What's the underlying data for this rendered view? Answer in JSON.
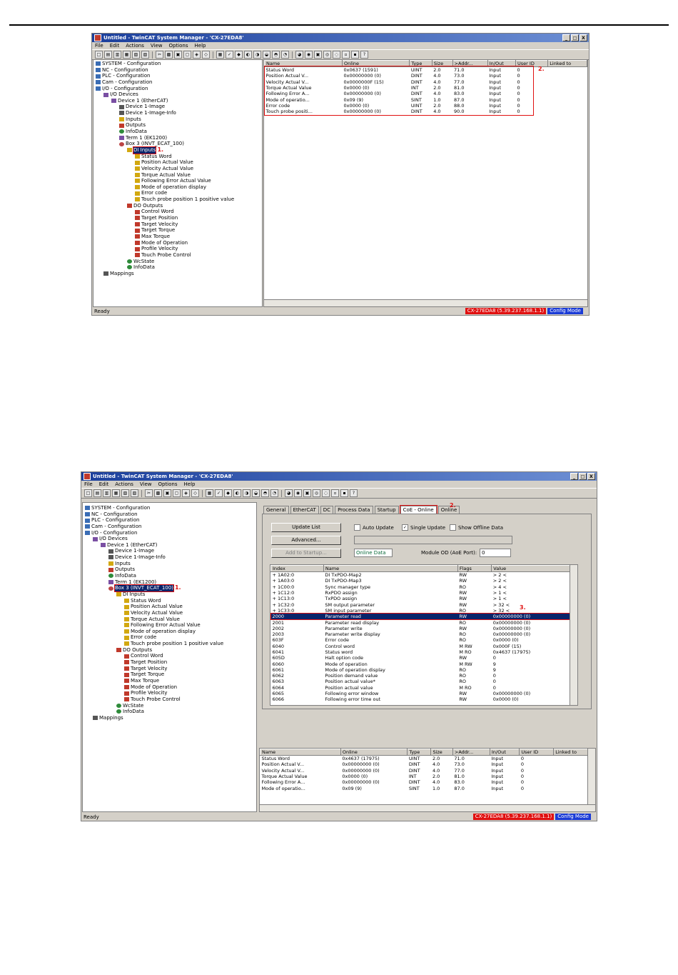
{
  "window_title": "Untitled - TwinCAT System Manager - 'CX-27EDA8'",
  "window_controls": [
    "_",
    "□",
    "X"
  ],
  "menu": [
    "File",
    "Edit",
    "Actions",
    "View",
    "Options",
    "Help"
  ],
  "status": {
    "ready": "Ready",
    "target": "CX-27EDA8 (5.39.237.168.1.1)",
    "mode": "Config Mode"
  },
  "callouts": {
    "one": "1.",
    "two": "2.",
    "three": "3."
  },
  "s1": {
    "tree": [
      {
        "label": "SYSTEM - Configuration",
        "indent": 0,
        "icon": "sys"
      },
      {
        "label": "NC - Configuration",
        "indent": 0,
        "icon": "sys"
      },
      {
        "label": "PLC - Configuration",
        "indent": 0,
        "icon": "sys"
      },
      {
        "label": "Cam - Configuration",
        "indent": 0,
        "icon": "sys"
      },
      {
        "label": "I/O - Configuration",
        "indent": 0,
        "icon": "sys"
      },
      {
        "label": "I/O Devices",
        "indent": 1,
        "icon": "dev"
      },
      {
        "label": "Device 1 (EtherCAT)",
        "indent": 2,
        "icon": "dev"
      },
      {
        "label": "Device 1-Image",
        "indent": 3,
        "icon": "map"
      },
      {
        "label": "Device 1-Image-Info",
        "indent": 3,
        "icon": "map"
      },
      {
        "label": "Inputs",
        "indent": 3,
        "icon": "in"
      },
      {
        "label": "Outputs",
        "indent": 3,
        "icon": "out"
      },
      {
        "label": "InfoData",
        "indent": 3,
        "icon": "ok"
      },
      {
        "label": "Term 1 (EK1200)",
        "indent": 3,
        "icon": "dev"
      },
      {
        "label": "Box 3 (INVT_ECAT_100)",
        "indent": 3,
        "icon": "box"
      },
      {
        "label": "DI Inputs",
        "indent": 4,
        "icon": "in",
        "hl": true,
        "callout": "1."
      },
      {
        "label": "Status Word",
        "indent": 5,
        "icon": "in"
      },
      {
        "label": "Position Actual Value",
        "indent": 5,
        "icon": "in"
      },
      {
        "label": "Velocity Actual Value",
        "indent": 5,
        "icon": "in"
      },
      {
        "label": "Torque Actual Value",
        "indent": 5,
        "icon": "in"
      },
      {
        "label": "Following Error Actual Value",
        "indent": 5,
        "icon": "in"
      },
      {
        "label": "Mode of operation display",
        "indent": 5,
        "icon": "in"
      },
      {
        "label": "Error code",
        "indent": 5,
        "icon": "in"
      },
      {
        "label": "Touch probe position 1 positive value",
        "indent": 5,
        "icon": "in"
      },
      {
        "label": "DO Outputs",
        "indent": 4,
        "icon": "out"
      },
      {
        "label": "Control Word",
        "indent": 5,
        "icon": "out"
      },
      {
        "label": "Target Position",
        "indent": 5,
        "icon": "out"
      },
      {
        "label": "Target Velocity",
        "indent": 5,
        "icon": "out"
      },
      {
        "label": "Target Torque",
        "indent": 5,
        "icon": "out"
      },
      {
        "label": "Max Torque",
        "indent": 5,
        "icon": "out"
      },
      {
        "label": "Mode of Operation",
        "indent": 5,
        "icon": "out"
      },
      {
        "label": "Profile Velocity",
        "indent": 5,
        "icon": "out"
      },
      {
        "label": "Touch Probe Control",
        "indent": 5,
        "icon": "out"
      },
      {
        "label": "WcState",
        "indent": 4,
        "icon": "ok"
      },
      {
        "label": "InfoData",
        "indent": 4,
        "icon": "ok"
      },
      {
        "label": "Mappings",
        "indent": 1,
        "icon": "map"
      }
    ],
    "var_headers": [
      "Name",
      "Online",
      "Type",
      "Size",
      ">Addr...",
      "In/Out",
      "User ID",
      "Linked to"
    ],
    "var_rows": [
      [
        "Status Word",
        "0x0637 (1591)",
        "UINT",
        "2.0",
        "71.0",
        "Input",
        "0"
      ],
      [
        "Position Actual V...",
        "0x00000000 (0)",
        "DINT",
        "4.0",
        "73.0",
        "Input",
        "0"
      ],
      [
        "Velocity Actual V...",
        "0x0000000F (15)",
        "DINT",
        "4.0",
        "77.0",
        "Input",
        "0"
      ],
      [
        "Torque Actual Value",
        "0x0000 (0)",
        "INT",
        "2.0",
        "81.0",
        "Input",
        "0"
      ],
      [
        "Following Error A...",
        "0x00000000 (0)",
        "DINT",
        "4.0",
        "83.0",
        "Input",
        "0"
      ],
      [
        "Mode of operatio...",
        "0x09 (9)",
        "SINT",
        "1.0",
        "87.0",
        "Input",
        "0"
      ],
      [
        "Error code",
        "0x0000 (0)",
        "UINT",
        "2.0",
        "88.0",
        "Input",
        "0"
      ],
      [
        "Touch probe positi...",
        "0x00000000 (0)",
        "DINT",
        "4.0",
        "90.0",
        "Input",
        "0"
      ]
    ]
  },
  "s2": {
    "tree": [
      {
        "label": "SYSTEM - Configuration",
        "indent": 0,
        "icon": "sys"
      },
      {
        "label": "NC - Configuration",
        "indent": 0,
        "icon": "sys"
      },
      {
        "label": "PLC - Configuration",
        "indent": 0,
        "icon": "sys"
      },
      {
        "label": "Cam - Configuration",
        "indent": 0,
        "icon": "sys"
      },
      {
        "label": "I/O - Configuration",
        "indent": 0,
        "icon": "sys"
      },
      {
        "label": "I/O Devices",
        "indent": 1,
        "icon": "dev"
      },
      {
        "label": "Device 1 (EtherCAT)",
        "indent": 2,
        "icon": "dev"
      },
      {
        "label": "Device 1-Image",
        "indent": 3,
        "icon": "map"
      },
      {
        "label": "Device 1-Image-Info",
        "indent": 3,
        "icon": "map"
      },
      {
        "label": "Inputs",
        "indent": 3,
        "icon": "in"
      },
      {
        "label": "Outputs",
        "indent": 3,
        "icon": "out"
      },
      {
        "label": "InfoData",
        "indent": 3,
        "icon": "ok"
      },
      {
        "label": "Term 1 (EK1200)",
        "indent": 3,
        "icon": "dev"
      },
      {
        "label": "Box 3 (INVT_ECAT_100)",
        "indent": 3,
        "icon": "box",
        "hl": true,
        "callout": "1."
      },
      {
        "label": "DI Inputs",
        "indent": 4,
        "icon": "in"
      },
      {
        "label": "Status Word",
        "indent": 5,
        "icon": "in"
      },
      {
        "label": "Position Actual Value",
        "indent": 5,
        "icon": "in"
      },
      {
        "label": "Velocity Actual Value",
        "indent": 5,
        "icon": "in"
      },
      {
        "label": "Torque Actual Value",
        "indent": 5,
        "icon": "in"
      },
      {
        "label": "Following Error Actual Value",
        "indent": 5,
        "icon": "in"
      },
      {
        "label": "Mode of operation display",
        "indent": 5,
        "icon": "in"
      },
      {
        "label": "Error code",
        "indent": 5,
        "icon": "in"
      },
      {
        "label": "Touch probe position 1 positive value",
        "indent": 5,
        "icon": "in"
      },
      {
        "label": "DO Outputs",
        "indent": 4,
        "icon": "out"
      },
      {
        "label": "Control Word",
        "indent": 5,
        "icon": "out"
      },
      {
        "label": "Target Position",
        "indent": 5,
        "icon": "out"
      },
      {
        "label": "Target Velocity",
        "indent": 5,
        "icon": "out"
      },
      {
        "label": "Target Torque",
        "indent": 5,
        "icon": "out"
      },
      {
        "label": "Max Torque",
        "indent": 5,
        "icon": "out"
      },
      {
        "label": "Mode of Operation",
        "indent": 5,
        "icon": "out"
      },
      {
        "label": "Profile Velocity",
        "indent": 5,
        "icon": "out"
      },
      {
        "label": "Touch Probe Control",
        "indent": 5,
        "icon": "out"
      },
      {
        "label": "WcState",
        "indent": 4,
        "icon": "ok"
      },
      {
        "label": "InfoData",
        "indent": 4,
        "icon": "ok"
      },
      {
        "label": "Mappings",
        "indent": 1,
        "icon": "map"
      }
    ],
    "tabs": [
      "General",
      "EtherCAT",
      "DC",
      "Process Data",
      "Startup",
      "CoE - Online",
      "Online"
    ],
    "active_tab": "CoE - Online",
    "update_list": "Update List",
    "auto_update": "Auto Update",
    "single_update": "Single Update",
    "show_offline": "Show Offline Data",
    "advanced": "Advanced...",
    "add_to_startup": "Add to Startup...",
    "online_data": "Online Data",
    "module_od_label": "Module OD (AoE Port):",
    "module_od_value": "0",
    "od_headers": [
      "Index",
      "Name",
      "Flags",
      "Value"
    ],
    "od_rows": [
      [
        "+ 1A02:0",
        "DI TxPDO-Map2",
        "RW",
        "> 2 <"
      ],
      [
        "+ 1A03:0",
        "DI TxPDO-Map3",
        "RW",
        "> 2 <"
      ],
      [
        "+ 1C00:0",
        "Sync manager type",
        "RO",
        "> 4 <"
      ],
      [
        "+ 1C12:0",
        "RxPDO assign",
        "RW",
        "> 1 <"
      ],
      [
        "+ 1C13:0",
        "TxPDO assign",
        "RW",
        "> 1 <"
      ],
      [
        "+ 1C32:0",
        "SM output parameter",
        "RW",
        "> 32 <"
      ],
      [
        "+ 1C33:0",
        "SM input parameter",
        "RO",
        "> 32 <"
      ],
      [
        "2000",
        "Parameter read",
        "RW",
        "0x00000000 (0)"
      ],
      [
        "2001",
        "Parameter read display",
        "RO",
        "0x00000000 (0)"
      ],
      [
        "2002",
        "Parameter write",
        "RW",
        "0x00000000 (0)"
      ],
      [
        "2003",
        "Parameter write display",
        "RO",
        "0x00000000 (0)"
      ],
      [
        "603F",
        "Error code",
        "RO",
        "0x0000 (0)"
      ],
      [
        "6040",
        "Control word",
        "M RW",
        "0x000F (15)"
      ],
      [
        "6041",
        "Status word",
        "M RO",
        "0x4637 (17975)"
      ],
      [
        "605D",
        "Halt option code",
        "RW",
        "0"
      ],
      [
        "6060",
        "Mode of operation",
        "M RW",
        "9"
      ],
      [
        "6061",
        "Mode of operation display",
        "RO",
        "9"
      ],
      [
        "6062",
        "Position demand value",
        "RO",
        "0"
      ],
      [
        "6063",
        "Position actual value*",
        "RO",
        "0"
      ],
      [
        "6064",
        "Position actual value",
        "M RO",
        "0"
      ],
      [
        "6065",
        "Following error window",
        "RW",
        "0x00000000 (0)"
      ],
      [
        "6066",
        "Following error time out",
        "RW",
        "0x0000 (0)"
      ]
    ],
    "var_headers": [
      "Name",
      "Online",
      "Type",
      "Size",
      ">Addr...",
      "In/Out",
      "User ID",
      "Linked to"
    ],
    "var_rows": [
      [
        "Status Word",
        "0x4637 (17975)",
        "UINT",
        "2.0",
        "71.0",
        "Input",
        "0"
      ],
      [
        "Position Actual V...",
        "0x00000000 (0)",
        "DINT",
        "4.0",
        "73.0",
        "Input",
        "0"
      ],
      [
        "Velocity Actual V...",
        "0x00000000 (0)",
        "DINT",
        "4.0",
        "77.0",
        "Input",
        "0"
      ],
      [
        "Torque Actual Value",
        "0x0000 (0)",
        "INT",
        "2.0",
        "81.0",
        "Input",
        "0"
      ],
      [
        "Following Error A...",
        "0x00000000 (0)",
        "DINT",
        "4.0",
        "83.0",
        "Input",
        "0"
      ],
      [
        "Mode of operatio...",
        "0x09 (9)",
        "SINT",
        "1.0",
        "87.0",
        "Input",
        "0"
      ]
    ]
  }
}
